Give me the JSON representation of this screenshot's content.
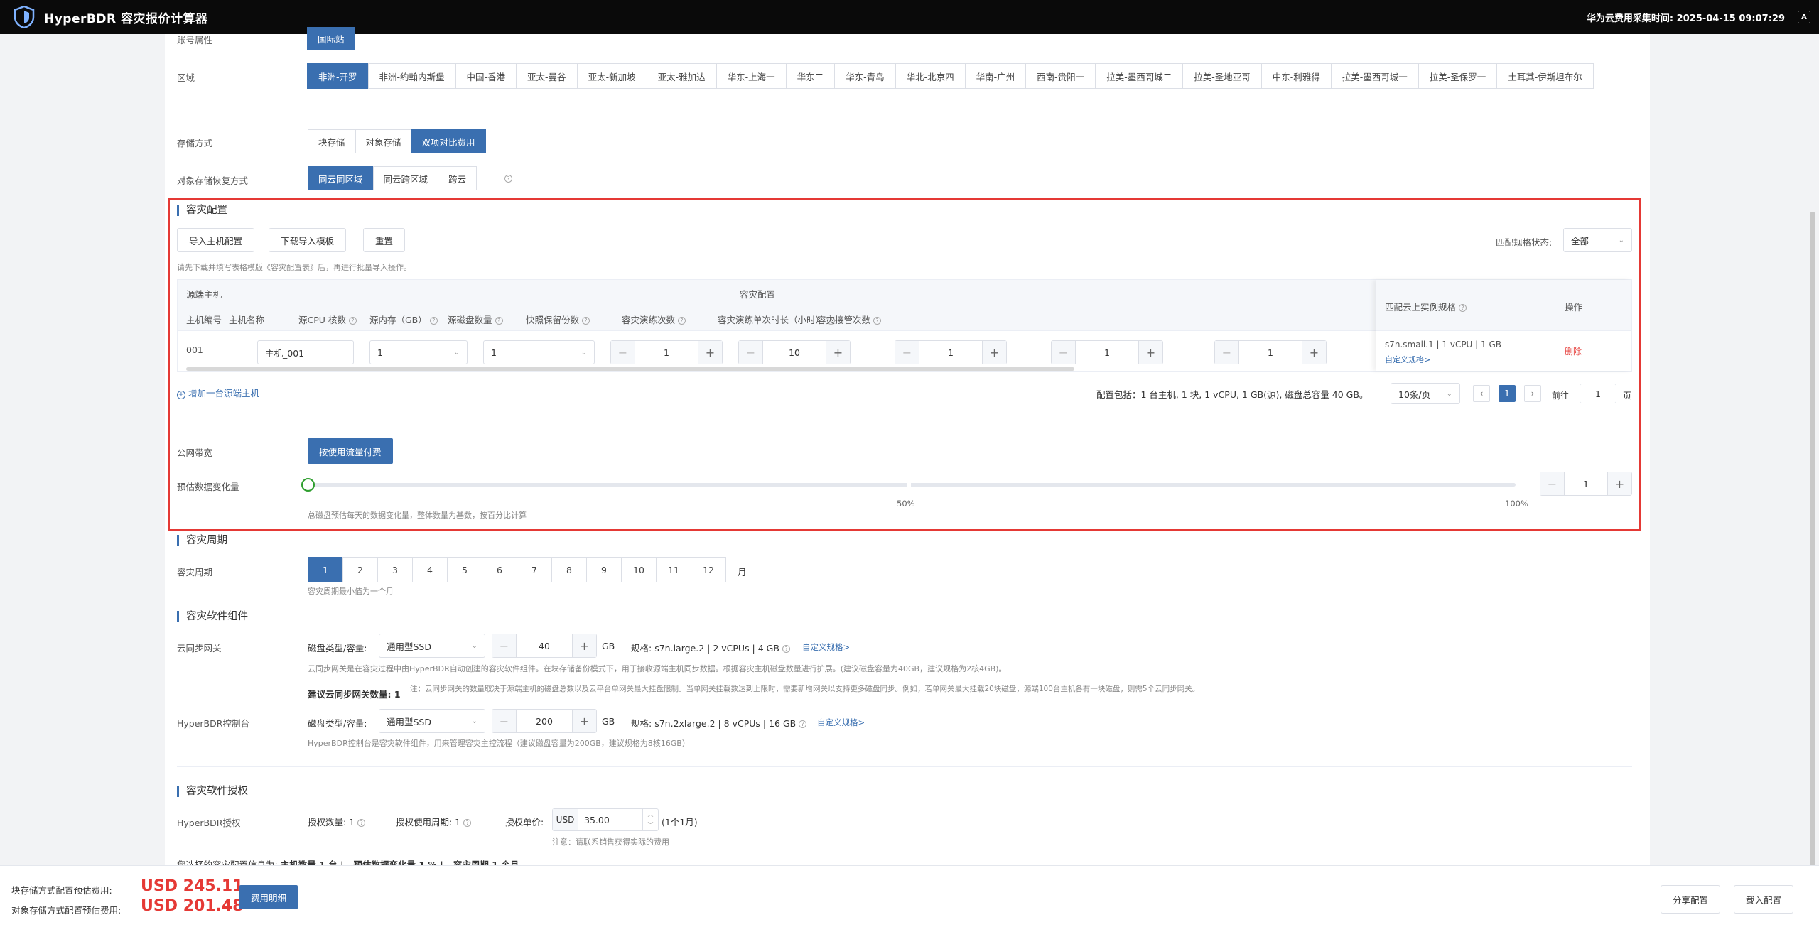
{
  "app": {
    "title": "HyperBDR 容灾报价计算器",
    "logo_icon": "shield-logo-icon",
    "collect_time_label": "华为云费用采集时间: 2025-04-15 09:07:29",
    "corner_icon": "A"
  },
  "account": {
    "label": "账号属性",
    "value": "国际站"
  },
  "region": {
    "label": "区域",
    "options": [
      "非洲-开罗",
      "非洲-约翰内斯堡",
      "中国-香港",
      "亚太-曼谷",
      "亚太-新加坡",
      "亚太-雅加达",
      "华东-上海一",
      "华东二",
      "华东-青岛",
      "华北-北京四",
      "华南-广州",
      "西南-贵阳一",
      "拉美-墨西哥城二",
      "拉美-圣地亚哥",
      "中东-利雅得",
      "拉美-墨西哥城一",
      "拉美-圣保罗一",
      "土耳其-伊斯坦布尔"
    ],
    "selected": "非洲-开罗"
  },
  "storage": {
    "label": "存储方式",
    "options": [
      "块存储",
      "对象存储",
      "双项对比费用"
    ],
    "selected": "双项对比费用"
  },
  "restore": {
    "label": "对象存储恢复方式",
    "options": [
      "同云同区域",
      "同云跨区域",
      "跨云"
    ],
    "selected": "同云同区域"
  },
  "dr_config": {
    "title": "容灾配置",
    "import_btn": "导入主机配置",
    "download_btn": "下载导入模板",
    "reset_btn": "重置",
    "hint": "请先下载并填写表格模版《容灾配置表》后，再进行批量导入操作。",
    "match_status_label": "匹配规格状态:",
    "match_status_value": "全部",
    "table": {
      "group_source": "源端主机",
      "group_dr": "容灾配置",
      "headers": [
        "主机编号",
        "主机名称",
        "源CPU 核数",
        "源内存（GB）",
        "源磁盘数量",
        "快照保留份数",
        "容灾演练次数",
        "容灾演练单次时长（小时）",
        "容灾接管次数"
      ],
      "header_match": "匹配云上实例规格",
      "header_action": "操作",
      "rows": [
        {
          "id": "001",
          "name": "主机_001",
          "cpu": "1",
          "mem": "1",
          "disks": "1",
          "snapshots": "10",
          "drills": "1",
          "drill_hours": "1",
          "takeovers": "1",
          "match": "s7n.small.1 | 1 vCPU | 1 GB",
          "custom": "自定义规格>",
          "delete": "删除"
        }
      ]
    },
    "add_host": "增加一台源端主机",
    "summary": "配置包括：1 台主机, 1 块, 1 vCPU, 1 GB(源), 磁盘总容量 40 GB。",
    "page_size": "10条/页",
    "current_page": "1",
    "goto_label": "前往",
    "goto_value": "1",
    "page_unit": "页",
    "bandwidth_label": "公网带宽",
    "bandwidth_btn": "按使用流量付费",
    "change_label": "预估数据变化量",
    "change_value": "1",
    "change_percent": 0.01,
    "slider_mid": "50%",
    "slider_max": "100%",
    "change_hint": "总磁盘预估每天的数据变化量，整体数量为基数，按百分比计算"
  },
  "period": {
    "title": "容灾周期",
    "label": "容灾周期",
    "options": [
      "1",
      "2",
      "3",
      "4",
      "5",
      "6",
      "7",
      "8",
      "9",
      "10",
      "11",
      "12"
    ],
    "selected": "1",
    "unit": "月",
    "hint": "容灾周期最小值为一个月"
  },
  "components": {
    "title": "容灾软件组件",
    "gateway": {
      "label": "云同步网关",
      "disk_label": "磁盘类型/容量:",
      "disk_type": "通用型SSD",
      "capacity": "40",
      "unit": "GB",
      "spec_label": "规格:",
      "spec": "s7n.large.2 | 2 vCPUs | 4 GB",
      "custom": "自定义规格>",
      "desc": "云同步网关是在容灾过程中由HyperBDR自动创建的容灾软件组件。在块存储备份模式下，用于接收源端主机同步数据。根据容灾主机磁盘数量进行扩展。(建议磁盘容量为40GB，建议规格为2核4GB)。",
      "count_label": "建议云同步网关数量: 1",
      "count_note": "注：云同步网关的数量取决于源端主机的磁盘总数以及云平台单网关最大挂盘限制。当单网关挂载数达到上限时，需要新增网关以支持更多磁盘同步。例如，若单网关最大挂载20块磁盘，源端100台主机各有一块磁盘，则需5个云同步网关。"
    },
    "console": {
      "label": "HyperBDR控制台",
      "disk_label": "磁盘类型/容量:",
      "disk_type": "通用型SSD",
      "capacity": "200",
      "unit": "GB",
      "spec_label": "规格:",
      "spec": "s7n.2xlarge.2 | 8 vCPUs | 16 GB",
      "custom": "自定义规格>",
      "desc": "HyperBDR控制台是容灾软件组件，用来管理容灾主控流程（建议磁盘容量为200GB，建议规格为8核16GB）"
    }
  },
  "license": {
    "title": "容灾软件授权",
    "label": "HyperBDR授权",
    "qty_label": "授权数量: 1",
    "period_label": "授权使用周期: 1",
    "price_label": "授权单价:",
    "currency": "USD",
    "price": "35.00",
    "price_unit": "(1个1月)",
    "note": "注意：请联系销售获得实际的费用"
  },
  "selection_summary": {
    "prefix": "您选择的容灾配置信息为:",
    "hosts": "主机数量 1 台 |",
    "change": "预估数据变化量 1 % |",
    "period": "容灾周期 1 个月"
  },
  "footer": {
    "block_label": "块存储方式配置预估费用:",
    "block_price": "USD 245.11",
    "object_label": "对象存储方式配置预估费用:",
    "object_price": "USD 201.48",
    "detail_btn": "费用明细",
    "share_btn": "分享配置",
    "load_btn": "载入配置"
  },
  "colors": {
    "primary": "#3a6fb0",
    "danger": "#e53935",
    "topbar": "#0a0a0a",
    "slider": "#2e9e2e"
  }
}
